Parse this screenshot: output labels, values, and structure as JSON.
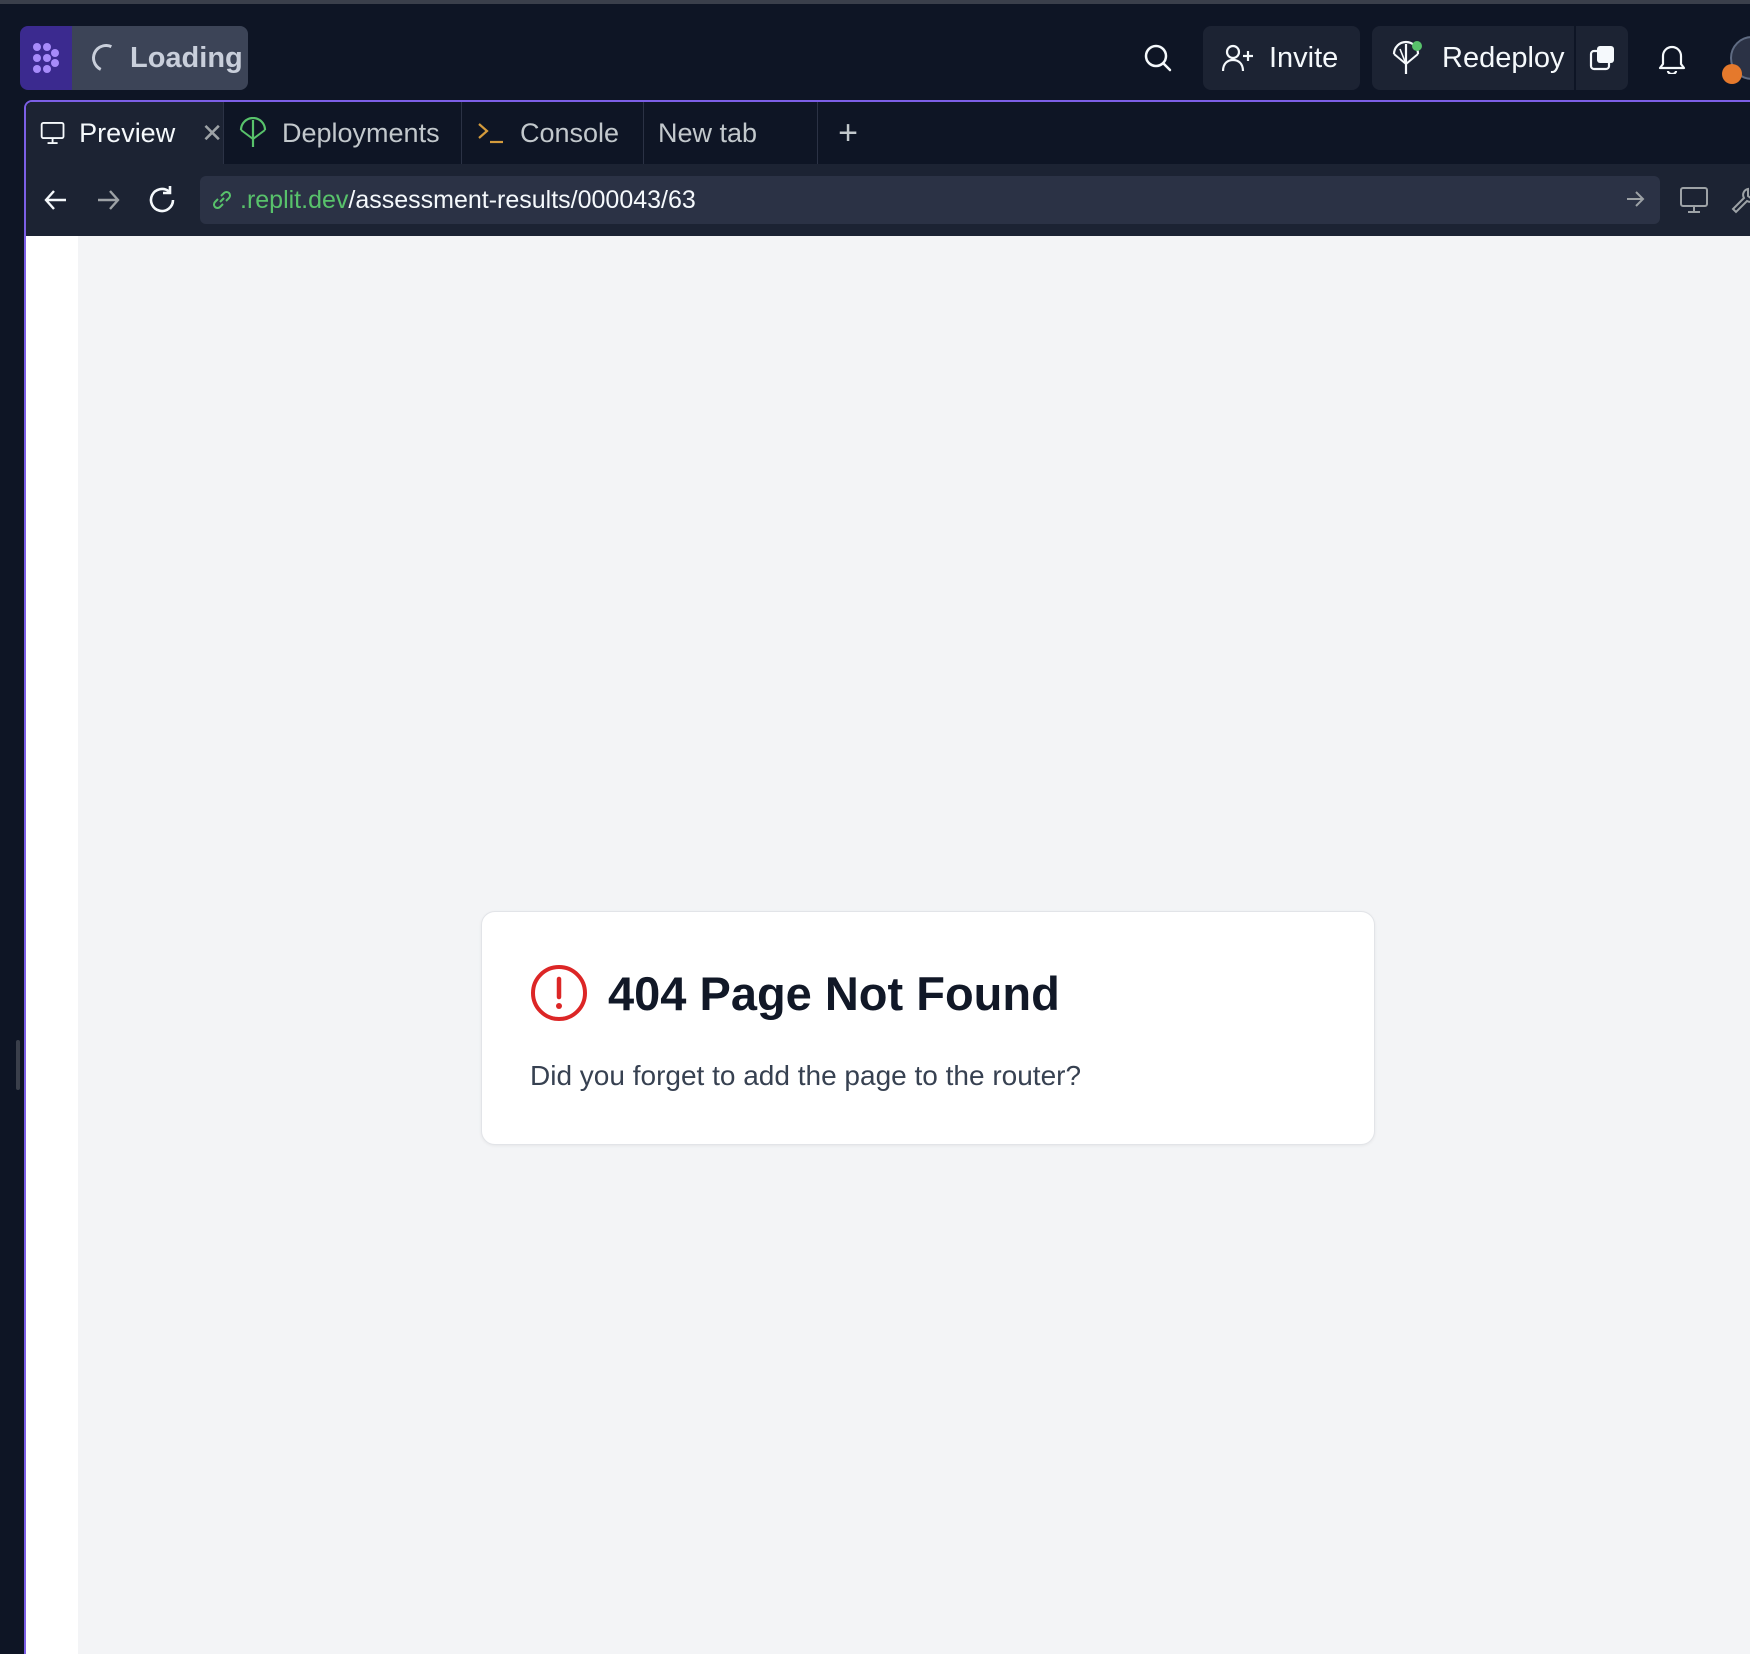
{
  "topbar": {
    "loading_label": "Loading",
    "invite_label": "Invite",
    "redeploy_label": "Redeploy"
  },
  "tabs": [
    {
      "label": "Preview",
      "icon": "monitor-icon",
      "active": true
    },
    {
      "label": "Deployments",
      "icon": "deploy-icon",
      "active": false
    },
    {
      "label": "Console",
      "icon": "terminal-icon",
      "active": false
    },
    {
      "label": "New tab",
      "active": false
    }
  ],
  "urlbar": {
    "domain": ".replit.dev",
    "path": "/assessment-results/000043/63"
  },
  "content": {
    "title": "404 Page Not Found",
    "message": "Did you forget to add the page to the router?"
  },
  "colors": {
    "accent": "#7c5fe6",
    "error": "#dc2626",
    "link_green": "#58c26b"
  }
}
